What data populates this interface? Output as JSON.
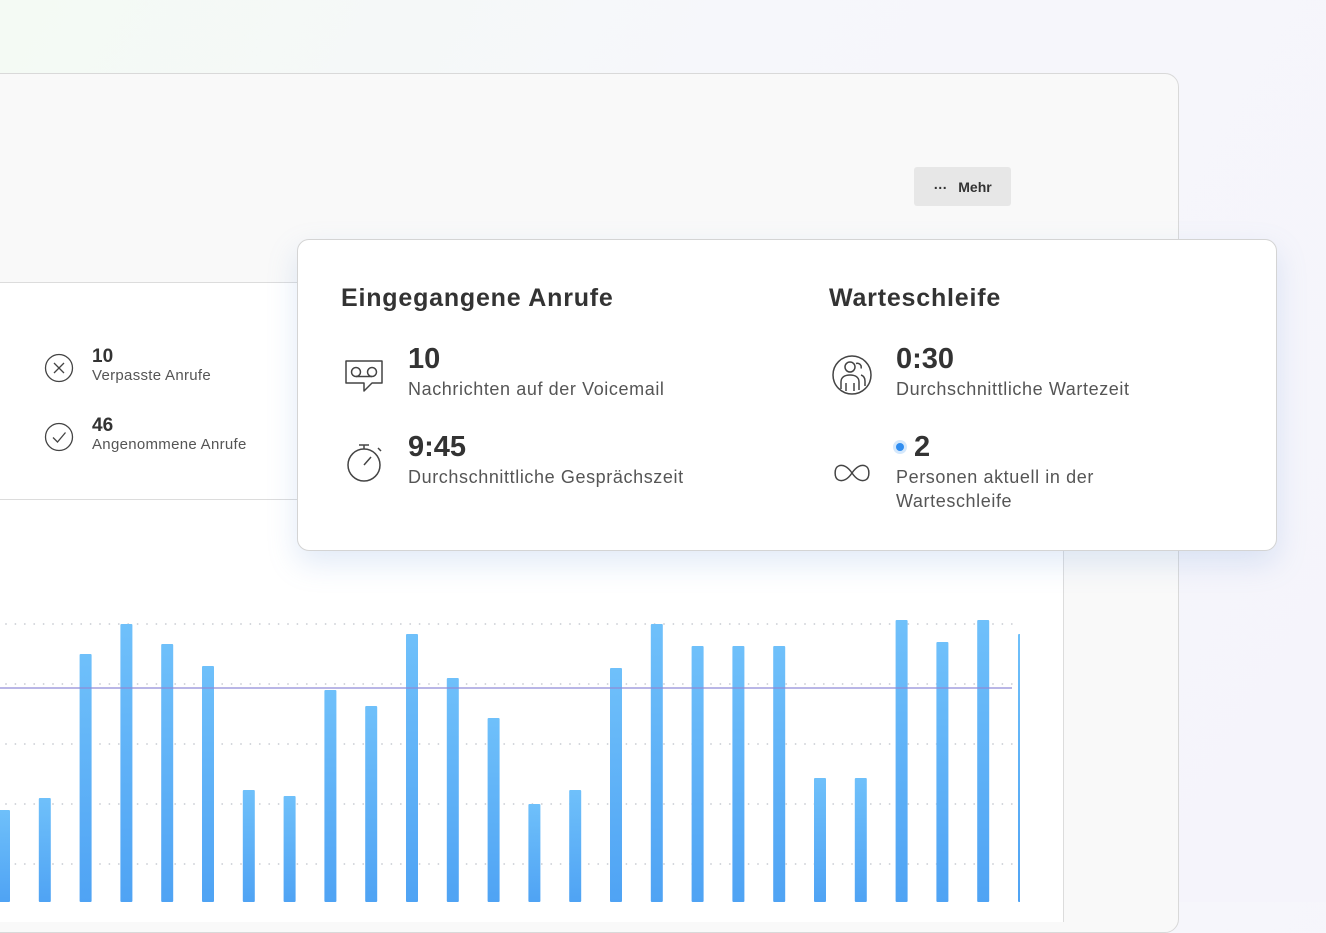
{
  "toolbar": {
    "more_label": "Mehr"
  },
  "summary": [
    {
      "value": "10",
      "label": "Verpasste Anrufe",
      "icon": "x-circle-icon"
    },
    {
      "value": "46",
      "label": "Angenommene Anrufe",
      "icon": "check-circle-icon"
    }
  ],
  "popover": {
    "incoming": {
      "title": "Eingegangene Anrufe",
      "voicemail": {
        "value": "10",
        "label": "Nachrichten auf der Voicemail",
        "icon": "voicemail-icon"
      },
      "talk_time": {
        "value": "9:45",
        "label": "Durchschnittliche Gesprächszeit",
        "icon": "stopwatch-icon"
      }
    },
    "queue": {
      "title": "Warteschleife",
      "wait_time": {
        "value": "0:30",
        "label": "Durchschnittliche Wartezeit",
        "icon": "people-icon"
      },
      "in_queue": {
        "value": "2",
        "label_line1": "Personen aktuell in der",
        "label_line2": "Warteschleife",
        "icon": "infinity-icon",
        "live_indicator": "#2f8df0"
      }
    }
  },
  "chart_data": {
    "type": "bar",
    "values": [
      46,
      52,
      124,
      139,
      129,
      118,
      56,
      53,
      106,
      98,
      134,
      112,
      92,
      49,
      56,
      117,
      139,
      128,
      128,
      128,
      62,
      62,
      141,
      130,
      141,
      134
    ],
    "reference_line": 107,
    "ylim": [
      0,
      150
    ],
    "grid": true,
    "colors": {
      "bar": "#6cbcf9",
      "bar_bottom": "#52a6f5",
      "reference_line": "#8f8bd6",
      "grid": "#c9ccd3"
    }
  }
}
